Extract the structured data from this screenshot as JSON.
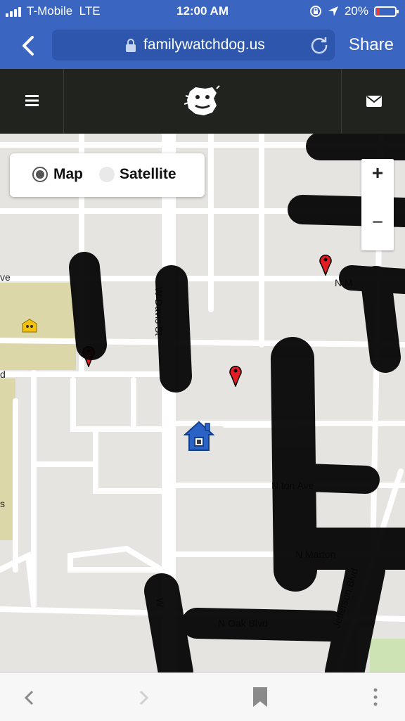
{
  "status_bar": {
    "carrier": "T-Mobile",
    "network": "LTE",
    "time": "12:00 AM",
    "battery": "20%",
    "battery_level": 0.2
  },
  "browser": {
    "url": "familywatchdog.us",
    "share_label": "Share"
  },
  "map": {
    "toggle": {
      "map_label": "Map",
      "satellite_label": "Satellite",
      "selected": "Map"
    },
    "zoom_in": "+",
    "zoom_out": "−",
    "street_labels": {
      "ave_left": "ve",
      "n_m": "N M",
      "d_left": "d",
      "s_left": "s",
      "ton_ave": "N    ton Ave",
      "n_marton": "N Marton",
      "n_oak": "N Oak      Blvd",
      "jefferson": "Jefferson Blvd",
      "w_davis": "W Davis St",
      "w_left": "W"
    },
    "markers": [
      "red-pin",
      "red-pin",
      "red-pin",
      "home"
    ]
  },
  "colors": {
    "header_blue": "#3a66c2",
    "appbar_dark": "#21231f",
    "map_bg": "#e6e4e0",
    "school_area": "#dcd7a8",
    "pin_red": "#e31b23"
  }
}
